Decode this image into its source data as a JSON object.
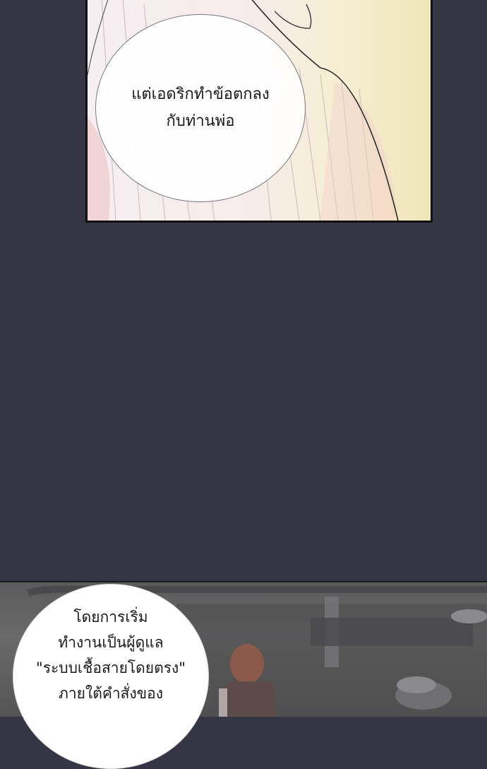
{
  "panels": {
    "top": {
      "bubble": {
        "lines": [
          "แต่เอดริกทำข้อตกลง",
          "กับท่านพ่อ"
        ]
      }
    },
    "bottom": {
      "bubble": {
        "lines": [
          "โดยการเริ่ม",
          "ทำงานเป็นผู้ดูแล",
          "\"ระบบเชื้อสายโดยตรง\"",
          "ภายใต้คำสั่งของ"
        ]
      }
    }
  },
  "colors": {
    "gutter": "#363546",
    "panel_border": "#111111",
    "bubble_fill": "#ffffff"
  }
}
